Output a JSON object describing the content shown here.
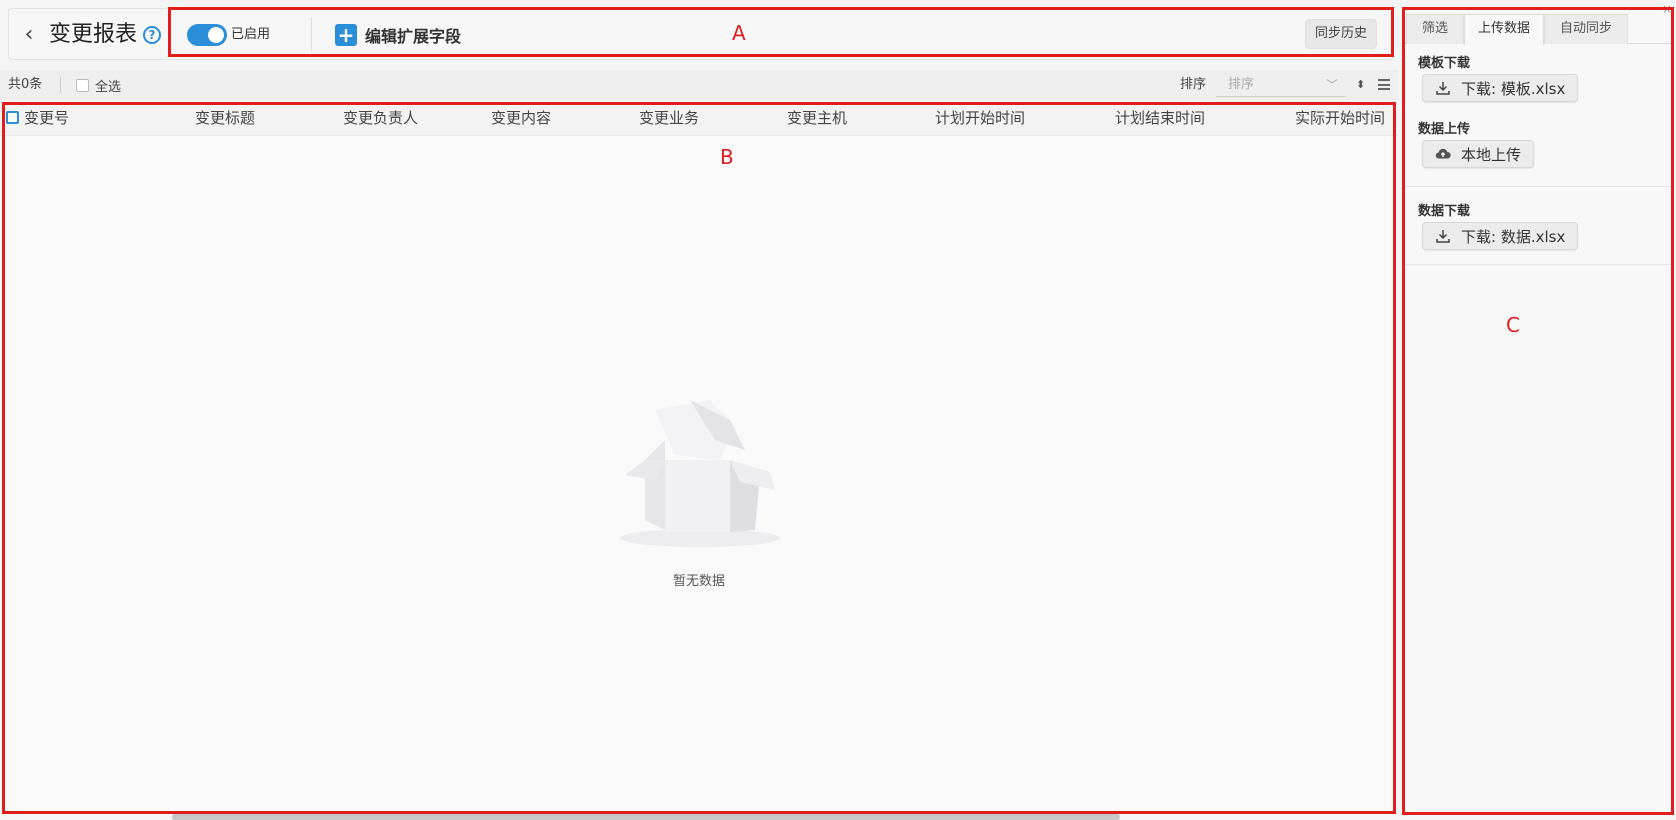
{
  "header": {
    "back_icon": "chevron-left-icon",
    "title": "变更报表",
    "help_icon": "help-circle-icon",
    "toggle": {
      "on": true,
      "label": "已启用"
    },
    "edit_fields_label": "编辑扩展字段",
    "sync_history_label": "同步历史"
  },
  "list_toolbar": {
    "count_label": "共0条",
    "select_all_label": "全选",
    "sort_label": "排序",
    "sort_placeholder": "排序"
  },
  "table": {
    "columns": [
      "变更号",
      "变更标题",
      "变更负责人",
      "变更内容",
      "变更业务",
      "变更主机",
      "计划开始时间",
      "计划结束时间",
      "实际开始时间"
    ],
    "rows": [],
    "empty_text": "暂无数据"
  },
  "panel": {
    "tabs": [
      {
        "label": "筛选",
        "active": false
      },
      {
        "label": "上传数据",
        "active": true
      },
      {
        "label": "自动同步",
        "active": false
      }
    ],
    "template_download": {
      "title": "模板下载",
      "button": "下载: 模板.xlsx"
    },
    "data_upload": {
      "title": "数据上传",
      "button": "本地上传"
    },
    "data_download": {
      "title": "数据下载",
      "button": "下载: 数据.xlsx"
    }
  },
  "annotations": {
    "a": "A",
    "b": "B",
    "c": "C"
  },
  "colors": {
    "accent": "#2a8fd8",
    "annotation": "#e01e1e"
  }
}
